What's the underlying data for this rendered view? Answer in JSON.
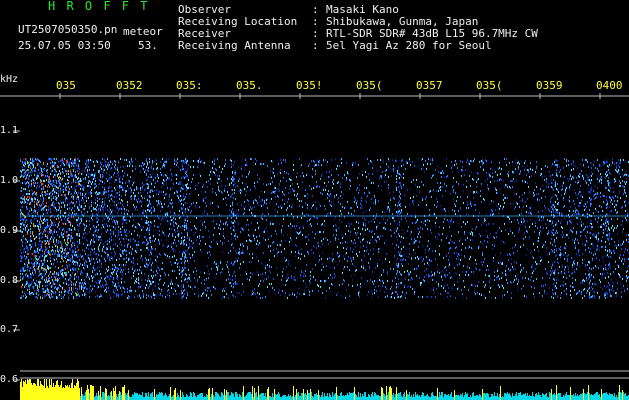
{
  "header": {
    "title": "H R O F F T",
    "filename": "UT2507050350.pn",
    "filename_suffix": "meteor",
    "datetime": "25.07.05 03:50",
    "count": "53."
  },
  "info": {
    "rows": [
      {
        "label": "Observer",
        "value": "Masaki Kano"
      },
      {
        "label": "Receiving Location",
        "value": "Shibukawa, Gunma, Japan"
      },
      {
        "label": "Receiver",
        "value": "RTL-SDR SDR# 43dB L15 96.7MHz CW"
      },
      {
        "label": "Receiving Antenna",
        "value": "5el Yagi Az 280 for Seoul"
      }
    ],
    "separator": ":"
  },
  "axis": {
    "unit": "kHz",
    "y_ticks": [
      "1.1",
      "1.0",
      "0.9",
      "0.8",
      "0.7",
      "0.6"
    ],
    "time_ticks": [
      "035",
      "0352",
      "035:",
      "035.",
      "035!",
      "035(",
      "0357",
      "035(",
      "0359",
      "0400"
    ]
  },
  "colors": {
    "title": "#27e827",
    "time_ticks": "#ffff3a",
    "text": "#f0f0f0",
    "background": "#000000"
  }
}
